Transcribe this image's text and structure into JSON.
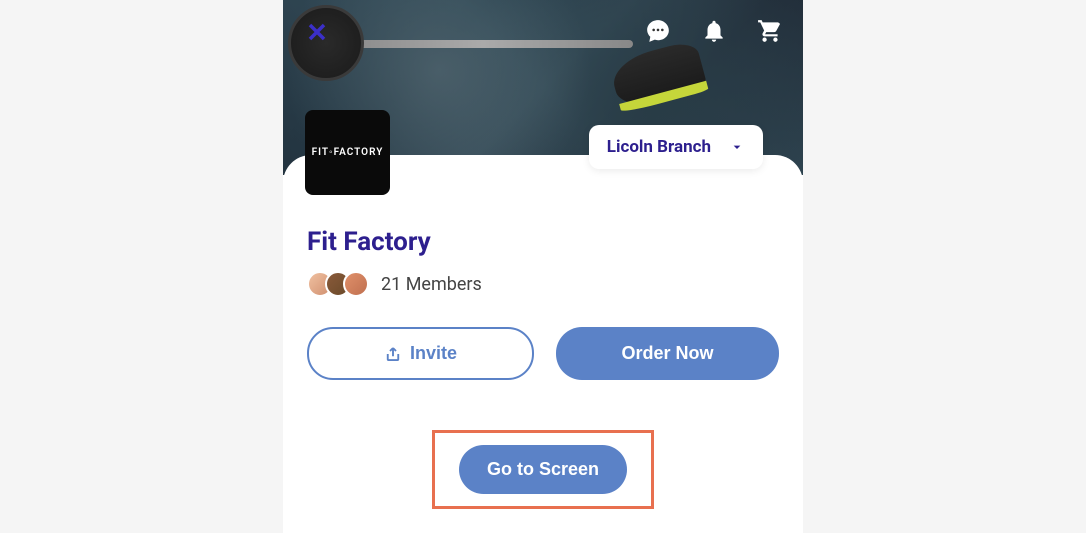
{
  "header": {
    "logo_text": "FIT◦FACTORY",
    "branch_label": "Licoln Branch"
  },
  "profile": {
    "title": "Fit Factory",
    "members_count": "21 Members"
  },
  "buttons": {
    "invite": "Invite",
    "order": "Order Now",
    "go_to_screen": "Go to Screen"
  },
  "colors": {
    "primary": "#2d1f8e",
    "button_blue": "#5b82c7",
    "highlight": "#e8704f"
  }
}
